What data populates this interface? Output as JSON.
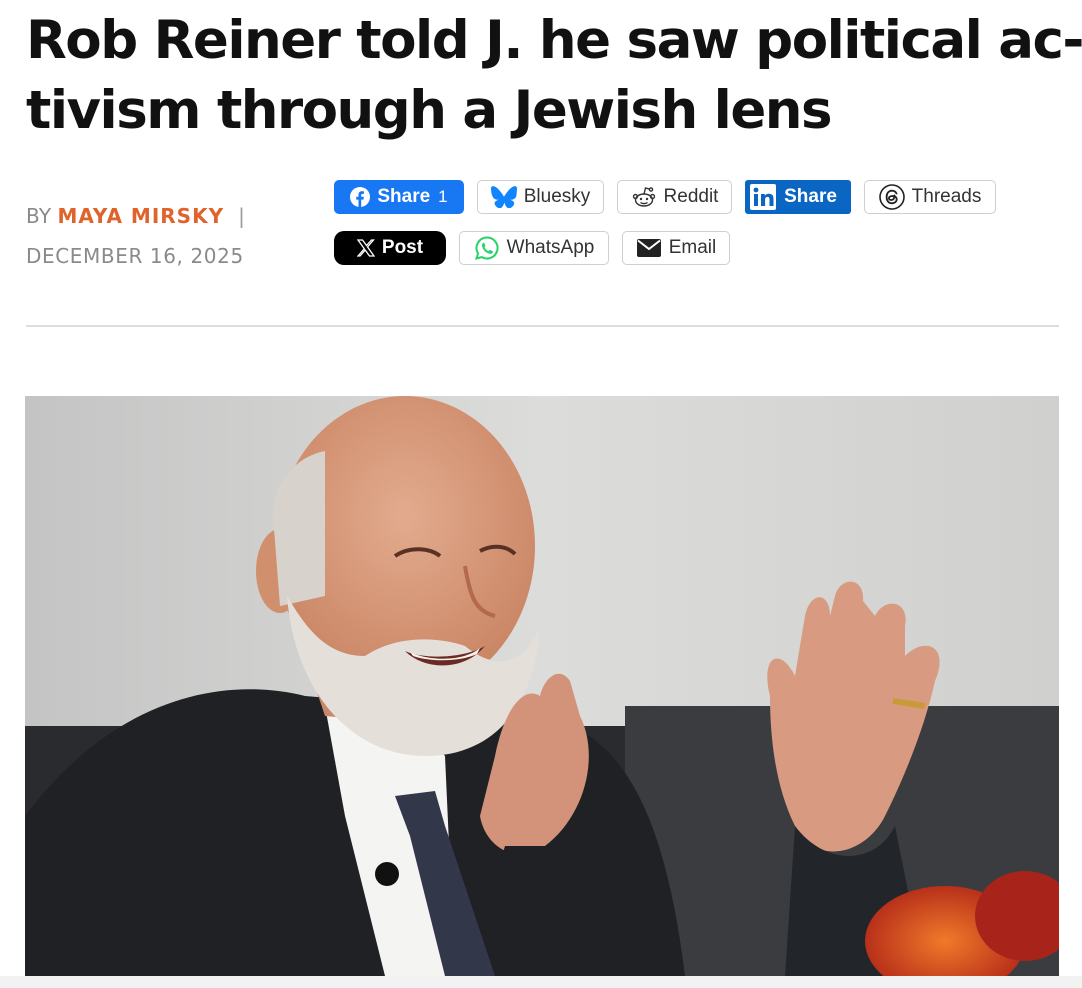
{
  "article": {
    "headline_line1": "Rob Reiner told J. he saw political ac-",
    "headline_line2": "tivism through a Jewish lens",
    "byline_prefix": "BY",
    "author": "MAYA MIRSKY",
    "separator": "|",
    "date": "DECEMBER 16, 2025"
  },
  "share": {
    "facebook": {
      "label": "Share",
      "count": "1",
      "icon": "facebook-icon",
      "color": "#1877f2"
    },
    "bluesky": {
      "label": "Bluesky",
      "icon": "butterfly-icon",
      "color": "#1185fe"
    },
    "reddit": {
      "label": "Reddit",
      "icon": "reddit-alien-icon"
    },
    "linkedin": {
      "label": "Share",
      "icon": "linkedin-icon",
      "color": "#0a66c2"
    },
    "threads": {
      "label": "Threads",
      "icon": "threads-icon"
    },
    "x": {
      "label": "Post",
      "icon": "x-logo-icon",
      "color": "#000000"
    },
    "whatsapp": {
      "label": "WhatsApp",
      "icon": "whatsapp-icon",
      "color": "#25d366"
    },
    "email": {
      "label": "Email",
      "icon": "envelope-icon"
    }
  },
  "colors": {
    "author_accent": "#e0632c",
    "headline": "#111111",
    "meta_gray": "#8a8a8a"
  }
}
